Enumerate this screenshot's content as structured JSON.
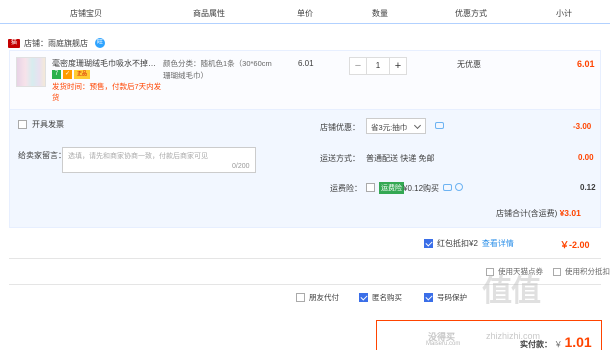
{
  "header": {
    "col_item": "店铺宝贝",
    "col_attr": "商品属性",
    "col_price": "单价",
    "col_qty": "数量",
    "col_promo": "优惠方式",
    "col_subtotal": "小计"
  },
  "store": {
    "label": "店铺：雨庭旗舰店",
    "tag_icon": "tmall-icon",
    "chat_icon": "wangwang-icon"
  },
  "item": {
    "title": "毫密度珊瑚绒毛巾吸水不掉毛割...",
    "badge_7": "7",
    "badge_2": "✓",
    "badge_3": "正品",
    "shipping_note": "发货时间：预售，付款后7天内发货",
    "attr": "颜色分类：随机色1条（30*60cm珊瑚绒毛巾）",
    "price": "6.01",
    "qty": "1",
    "qty_minus": "−",
    "qty_plus": "+",
    "promo": "无优惠",
    "subtotal": "6.01"
  },
  "invoice": {
    "label": "开具发票"
  },
  "message": {
    "label": "给卖家留言：",
    "placeholder": "选填，请先和商家协商一致，付款后商家可见",
    "count": "0/200"
  },
  "coupon": {
    "label": "店铺优惠：",
    "selected": "省3元:抽巾",
    "value": "-3.00"
  },
  "shipping": {
    "label": "运送方式：",
    "value_text": "普通配送 快递 免邮",
    "value": "0.00"
  },
  "insurance": {
    "label": "运费险：",
    "tag": "运费险",
    "price_text": "¥0.12购买",
    "value": "0.12"
  },
  "store_total": {
    "label": "店铺合计(含运费)",
    "value": "¥3.01"
  },
  "hongbao": {
    "label": "红包抵扣¥2",
    "link": "查看详情",
    "value": "￥-2.00"
  },
  "mini": {
    "left": "使用天猫点券",
    "right": "使用积分抵扣"
  },
  "bottom": {
    "friend_pay": "朋友代付",
    "anon_buy": "匿名购买",
    "protect": "号码保护"
  },
  "pay": {
    "label": "实付款：",
    "currency": "￥",
    "amount": "1.01"
  },
  "watermark": {
    "big": "值值",
    "cn": "没得买",
    "site": "zhizhizhi.com",
    "sub": "Maiseru.com"
  },
  "colors": {
    "accent_red": "#ff4400",
    "header_line": "#b2d1ff",
    "panel_bg": "#f2f7ff",
    "link_blue": "#2b8fe8",
    "check_blue": "#3a6ee8"
  }
}
